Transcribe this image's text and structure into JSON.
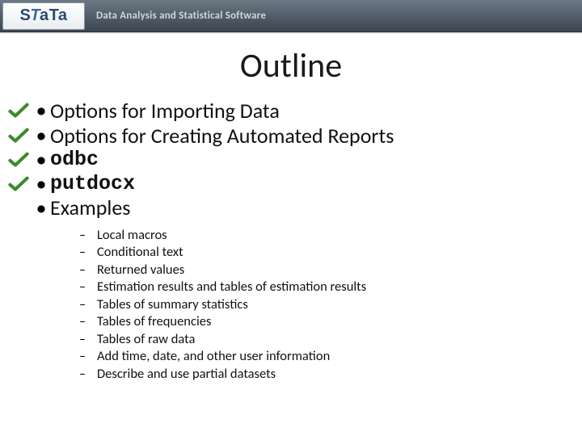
{
  "header": {
    "logo": "stata",
    "tagline": "Data Analysis and Statistical Software"
  },
  "title": "Outline",
  "bullets": [
    {
      "text": "Options for Importing Data",
      "checked": true,
      "code": false
    },
    {
      "text": "Options for Creating Automated Reports",
      "checked": true,
      "code": false
    },
    {
      "text": "odbc",
      "checked": true,
      "code": true
    },
    {
      "text": "putdocx",
      "checked": true,
      "code": true
    },
    {
      "text": "Examples",
      "checked": false,
      "code": false
    }
  ],
  "sub_bullets": [
    "Local macros",
    "Conditional text",
    "Returned values",
    "Estimation results and tables of estimation results",
    "Tables of summary statistics",
    "Tables of frequencies",
    "Tables of raw data",
    "Add time, date, and other user information",
    "Describe and use partial datasets"
  ]
}
